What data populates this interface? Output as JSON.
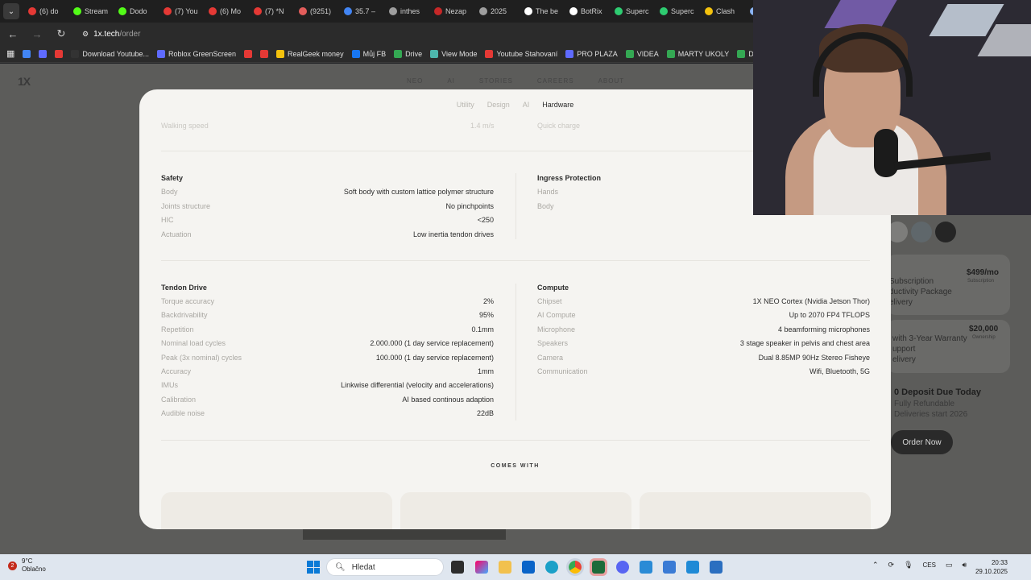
{
  "browser": {
    "tabs": [
      {
        "label": "(6) do",
        "color": "#e53935"
      },
      {
        "label": "Stream",
        "color": "#53fc18"
      },
      {
        "label": "Dodo",
        "color": "#53fc18"
      },
      {
        "label": "(7) You",
        "color": "#e53935"
      },
      {
        "label": "(6) Mo",
        "color": "#e53935"
      },
      {
        "label": "(7) *N",
        "color": "#e53935"
      },
      {
        "label": "(9251)",
        "color": "#e35d5b"
      },
      {
        "label": "35.7 –",
        "color": "#4285f4"
      },
      {
        "label": "inthes",
        "color": "#9e9e9e"
      },
      {
        "label": "Nezap",
        "color": "#c62828"
      },
      {
        "label": "2025",
        "color": "#9e9e9e"
      },
      {
        "label": "The be",
        "color": "#ffffff"
      },
      {
        "label": "BotRix",
        "color": "#ffffff"
      },
      {
        "label": "Superc",
        "color": "#2ecc71"
      },
      {
        "label": "Superc",
        "color": "#2ecc71"
      },
      {
        "label": "Clash",
        "color": "#f4c20d"
      },
      {
        "label": "",
        "color": "#8ab4f8"
      }
    ],
    "url_host": "1x.tech",
    "url_path": "/order",
    "bookmarks": [
      {
        "label": "",
        "color": "#4285f4"
      },
      {
        "label": "",
        "color": "#5f6bff"
      },
      {
        "label": "",
        "color": "#e53935"
      },
      {
        "label": "Download Youtube...",
        "color": "#333333"
      },
      {
        "label": "Roblox GreenScreen",
        "color": "#5f6bff"
      },
      {
        "label": "",
        "color": "#e53935"
      },
      {
        "label": "",
        "color": "#e53935"
      },
      {
        "label": "RealGeek money",
        "color": "#f4c20d"
      },
      {
        "label": "Můj FB",
        "color": "#1877f2"
      },
      {
        "label": "Drive",
        "color": "#34a853"
      },
      {
        "label": "View Mode",
        "color": "#4db6ac"
      },
      {
        "label": "Youtube Stahovaní",
        "color": "#e53935"
      },
      {
        "label": "PRO PLAZA",
        "color": "#5f6bff"
      },
      {
        "label": "VIDEA",
        "color": "#34a853"
      },
      {
        "label": "MARTY UKOLY",
        "color": "#34a853"
      },
      {
        "label": "Dodo videa",
        "color": "#34a853"
      }
    ]
  },
  "site": {
    "logo": "1X",
    "nav": [
      "NEO",
      "AI",
      "STORIES",
      "CAREERS",
      "ABOUT"
    ],
    "side": {
      "sub_line1": "Subscription",
      "sub_line2": "ductivity Package",
      "sub_line3": "elivery",
      "sub_price": "$499/mo",
      "sub_price_note": "Subscription",
      "own_line1": "with 3-Year Warranty",
      "own_line2": "upport",
      "own_line3": "elivery",
      "own_price": "$20,000",
      "own_price_note": "Ownership",
      "deposit_title": "0 Deposit Due Today",
      "deposit_line1": "Fully Refundable",
      "deposit_line2": "Deliveries start 2026",
      "order_button": "Order Now"
    }
  },
  "modal": {
    "tabs": [
      "Utility",
      "Design",
      "AI",
      "Hardware"
    ],
    "active_tab": "Hardware",
    "faded_left_label": "Walking speed",
    "faded_left_value": "1.4 m/s",
    "faded_right_label": "Quick charge",
    "safety": {
      "title": "Safety",
      "rows": [
        {
          "label": "Body",
          "value": "Soft body with custom lattice polymer structure"
        },
        {
          "label": "Joints structure",
          "value": "No pinchpoints"
        },
        {
          "label": "HIC",
          "value": "<250"
        },
        {
          "label": "Actuation",
          "value": "Low inertia tendon drives"
        }
      ]
    },
    "ingress": {
      "title": "Ingress Protection",
      "rows": [
        {
          "label": "Hands",
          "value": ""
        },
        {
          "label": "Body",
          "value": ""
        }
      ]
    },
    "tendon": {
      "title": "Tendon Drive",
      "rows": [
        {
          "label": "Torque accuracy",
          "value": "2%"
        },
        {
          "label": "Backdrivability",
          "value": "95%"
        },
        {
          "label": "Repetition",
          "value": "0.1mm"
        },
        {
          "label": "Nominal load cycles",
          "value": "2.000.000 (1 day service replacement)"
        },
        {
          "label": "Peak (3x nominal) cycles",
          "value": "100.000 (1 day service replacement)"
        },
        {
          "label": "Accuracy",
          "value": "1mm"
        },
        {
          "label": "IMUs",
          "value": "Linkwise differential (velocity and accelerations)"
        },
        {
          "label": "Calibration",
          "value": "AI based continous adaption"
        },
        {
          "label": "Audible noise",
          "value": "22dB"
        }
      ]
    },
    "compute": {
      "title": "Compute",
      "rows": [
        {
          "label": "Chipset",
          "value": "1X NEO Cortex (Nvidia Jetson Thor)"
        },
        {
          "label": "AI Compute",
          "value": "Up to 2070 FP4 TFLOPS"
        },
        {
          "label": "Microphone",
          "value": "4 beamforming microphones"
        },
        {
          "label": "Speakers",
          "value": "3 stage speaker in pelvis and chest area"
        },
        {
          "label": "Camera",
          "value": "Dual 8.85MP 90Hz Stereo Fisheye"
        },
        {
          "label": "Communication",
          "value": "Wifi, Bluetooth, 5G"
        }
      ]
    },
    "comes_with": "COMES WITH"
  },
  "taskbar": {
    "weather_badge": "2",
    "temperature": "9°C",
    "weather": "Oblačno",
    "search_placeholder": "Hledat",
    "language": "CES",
    "time": "20:33",
    "date": "29.10.2025"
  }
}
